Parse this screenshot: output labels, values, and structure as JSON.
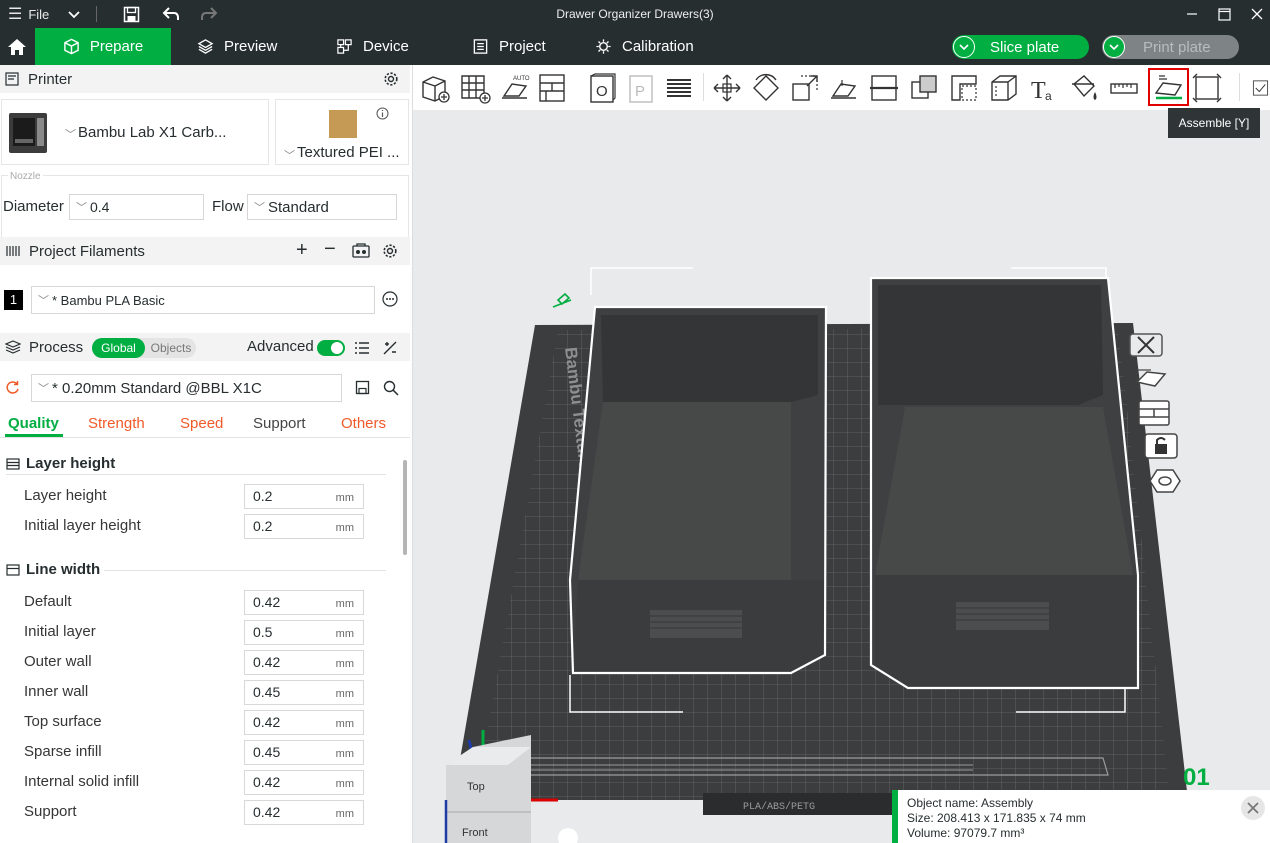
{
  "window": {
    "menu_label": "File",
    "title": "Drawer Organizer Drawers(3)"
  },
  "tabs": [
    {
      "label": "Prepare",
      "icon": "cube-icon"
    },
    {
      "label": "Preview",
      "icon": "layers-icon"
    },
    {
      "label": "Device",
      "icon": "device-icon"
    },
    {
      "label": "Project",
      "icon": "project-icon"
    },
    {
      "label": "Calibration",
      "icon": "calibration-icon"
    }
  ],
  "actions": {
    "slice_plate": "Slice plate",
    "print_plate": "Print plate"
  },
  "printer": {
    "section_title": "Printer",
    "printer_name": "Bambu Lab X1 Carb...",
    "plate_name": "Textured PEI ...",
    "nozzle_label": "Nozzle",
    "diameter_label": "Diameter",
    "diameter_value": "0.4",
    "flow_label": "Flow",
    "flow_value": "Standard"
  },
  "filaments": {
    "section_title": "Project Filaments",
    "items": [
      {
        "index": "1",
        "name": "* Bambu PLA Basic",
        "color": "#000000"
      }
    ]
  },
  "process": {
    "section_title": "Process",
    "toggle_global": "Global",
    "toggle_objects": "Objects",
    "advanced_label": "Advanced",
    "advanced_on": true,
    "preset": "* 0.20mm Standard @BBL X1C",
    "subtabs": [
      "Quality",
      "Strength",
      "Speed",
      "Support",
      "Others"
    ],
    "active_subtab": "Quality",
    "groups": [
      {
        "title": "Layer height",
        "params": [
          {
            "label": "Layer height",
            "value": "0.2",
            "unit": "mm"
          },
          {
            "label": "Initial layer height",
            "value": "0.2",
            "unit": "mm"
          }
        ]
      },
      {
        "title": "Line width",
        "params": [
          {
            "label": "Default",
            "value": "0.42",
            "unit": "mm"
          },
          {
            "label": "Initial layer",
            "value": "0.5",
            "unit": "mm"
          },
          {
            "label": "Outer wall",
            "value": "0.42",
            "unit": "mm"
          },
          {
            "label": "Inner wall",
            "value": "0.45",
            "unit": "mm"
          },
          {
            "label": "Top surface",
            "value": "0.42",
            "unit": "mm"
          },
          {
            "label": "Sparse infill",
            "value": "0.45",
            "unit": "mm"
          },
          {
            "label": "Internal solid infill",
            "value": "0.42",
            "unit": "mm"
          },
          {
            "label": "Support",
            "value": "0.42",
            "unit": "mm"
          }
        ]
      }
    ]
  },
  "viewport": {
    "tooltip": "Assemble [Y]",
    "plate_label": "Bambu Textured PEI Plate",
    "plate_number": "01",
    "plate_material_text": "PLA/ABS/PETG",
    "nav_top": "Top",
    "nav_front": "Front",
    "object_name": "Object name: Assembly",
    "object_size": "Size: 208.413 x 171.835 x 74 mm",
    "object_volume": "Volume: 97079.7 mm³"
  },
  "colors": {
    "accent": "#00ae42",
    "dark": "#262e30",
    "highlight": "#e00000",
    "subtab": "#f05a28"
  }
}
